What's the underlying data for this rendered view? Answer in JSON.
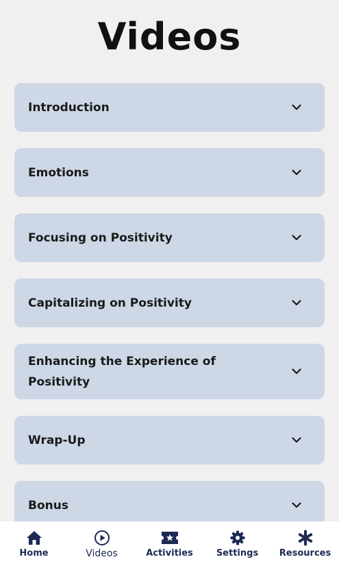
{
  "header": {
    "title": "Videos"
  },
  "sections": [
    {
      "label": "Introduction"
    },
    {
      "label": "Emotions"
    },
    {
      "label": "Focusing on Positivity"
    },
    {
      "label": "Capitalizing on Positivity"
    },
    {
      "label": "Enhancing the Experience of Positivity"
    },
    {
      "label": "Wrap-Up"
    },
    {
      "label": "Bonus"
    }
  ],
  "nav": {
    "items": [
      {
        "label": "Home",
        "icon": "home-icon"
      },
      {
        "label": "Videos",
        "icon": "play-circle-icon"
      },
      {
        "label": "Activities",
        "icon": "ticket-star-icon"
      },
      {
        "label": "Settings",
        "icon": "gear-icon"
      },
      {
        "label": "Resources",
        "icon": "asterisk-icon"
      }
    ],
    "active": "Videos"
  },
  "colors": {
    "background": "#f2eff1",
    "card": "#cdd7e6",
    "nav_text": "#1c2a54"
  }
}
